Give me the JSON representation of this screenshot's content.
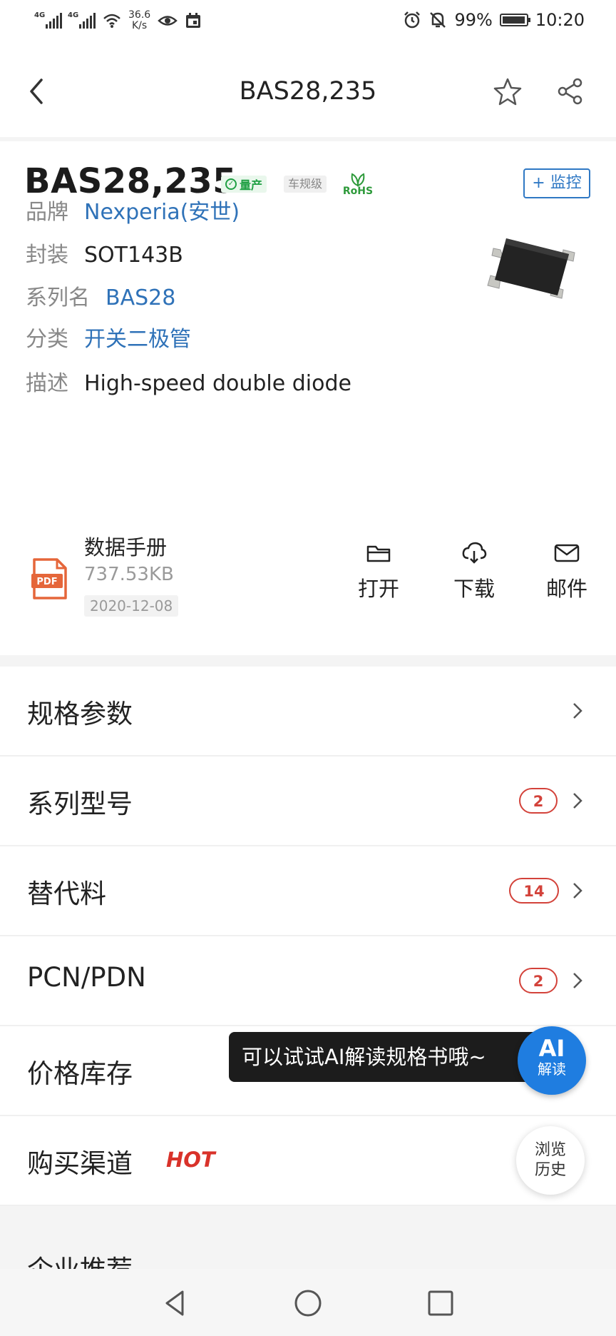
{
  "status_bar": {
    "network1": "4G",
    "network2": "4G",
    "speed_value": "36.6",
    "speed_unit": "K/s",
    "battery": "99%",
    "time": "10:20"
  },
  "header": {
    "title": "BAS28,235"
  },
  "product": {
    "part_number": "BAS28,235",
    "badge_mass": "量产",
    "badge_auto": "车规级",
    "badge_rohs": "RoHS",
    "monitor_label": "+ 监控",
    "fields": [
      {
        "label": "品牌",
        "value": "Nexperia(安世)"
      },
      {
        "label": "封装",
        "value": "SOT143B"
      },
      {
        "label": "系列名",
        "value": "BAS28"
      },
      {
        "label": "分类",
        "value": "开关二极管"
      },
      {
        "label": "描述",
        "value": "High-speed double diode"
      }
    ]
  },
  "datasheet": {
    "icon_text": "PDF",
    "title": "数据手册",
    "size": "737.53KB",
    "date": "2020-12-08",
    "actions": [
      {
        "label": "打开",
        "icon": "folder-icon"
      },
      {
        "label": "下载",
        "icon": "cloud-download-icon"
      },
      {
        "label": "邮件",
        "icon": "mail-icon"
      }
    ]
  },
  "menu": [
    {
      "label": "规格参数"
    },
    {
      "label": "系列型号",
      "count": "2"
    },
    {
      "label": "替代料",
      "count": "14"
    },
    {
      "label": "PCN/PDN",
      "count": "2"
    },
    {
      "label": "价格库存"
    },
    {
      "label": "购买渠道",
      "tag": "HOT"
    }
  ],
  "cut_off_text": "企业推荐",
  "tooltip": "可以试试AI解读规格书哦~",
  "ai_button": {
    "line1": "AI",
    "line2": "解读"
  },
  "history_button": {
    "line1": "浏览",
    "line2": "历史"
  }
}
